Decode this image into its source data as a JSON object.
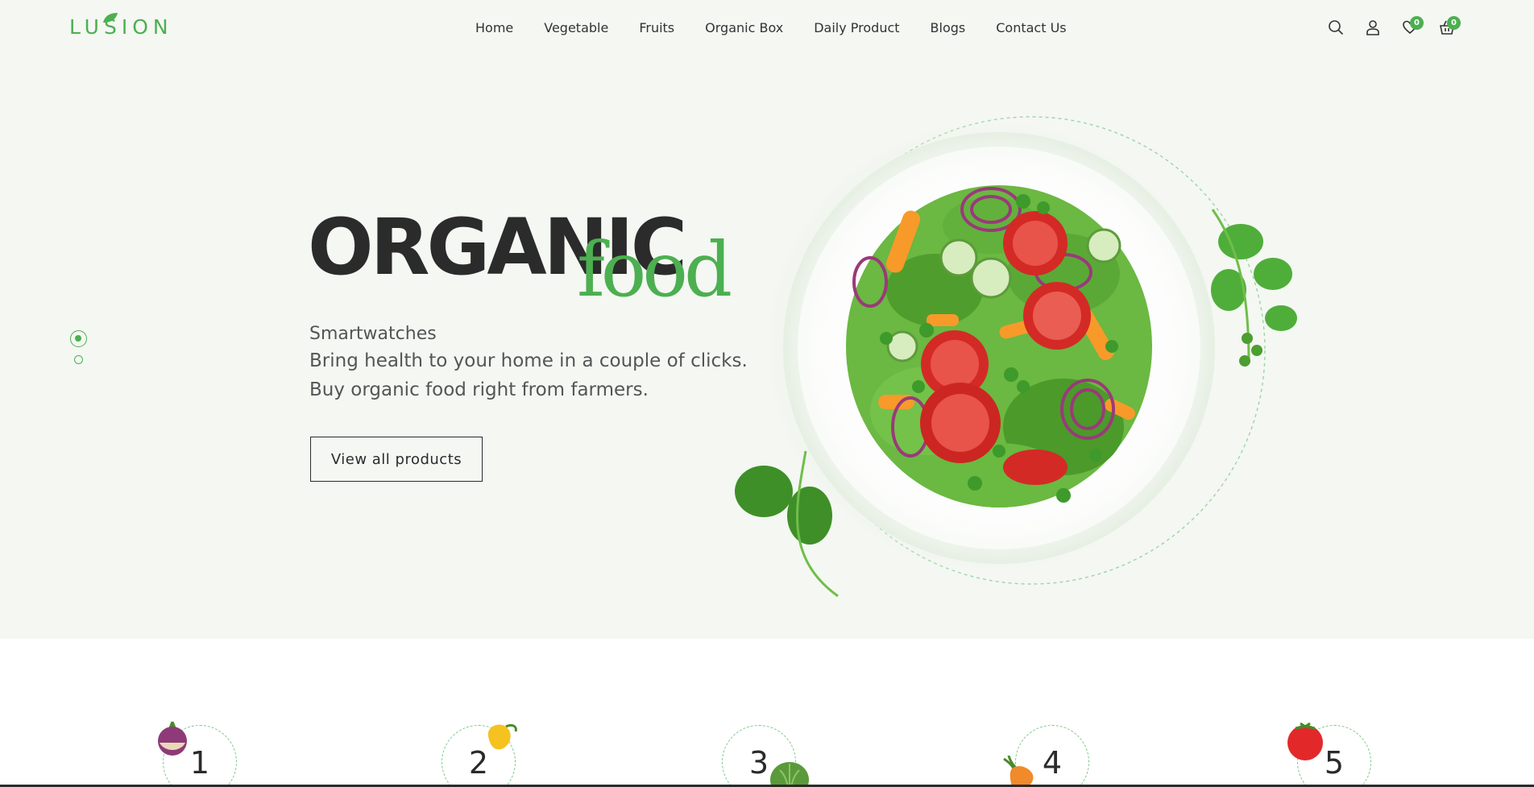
{
  "brand": {
    "logo_text": "LUSION",
    "accent_color": "#4caf50"
  },
  "nav": {
    "items": [
      {
        "label": "Home"
      },
      {
        "label": "Vegetable"
      },
      {
        "label": "Fruits"
      },
      {
        "label": "Organic Box"
      },
      {
        "label": "Daily Product"
      },
      {
        "label": "Blogs"
      },
      {
        "label": "Contact Us"
      }
    ]
  },
  "header_icons": {
    "search": "search-icon",
    "account": "user-icon",
    "wishlist": {
      "icon": "heart-icon",
      "count": "0"
    },
    "cart": {
      "icon": "basket-icon",
      "count": "0"
    }
  },
  "hero": {
    "title": "ORGANIC",
    "script": "food",
    "kicker": "Smartwatches",
    "line1": "Bring health to your home in a couple of clicks.",
    "line2": "Buy organic food right from farmers.",
    "button": "View all products",
    "slides": {
      "current": 1,
      "total": 2
    }
  },
  "steps": [
    {
      "number": "1",
      "icon": "beet-icon"
    },
    {
      "number": "2",
      "icon": "pepper-icon"
    },
    {
      "number": "3",
      "icon": "cabbage-icon"
    },
    {
      "number": "4",
      "icon": "carrot-icon"
    },
    {
      "number": "5",
      "icon": "tomato-icon"
    }
  ]
}
